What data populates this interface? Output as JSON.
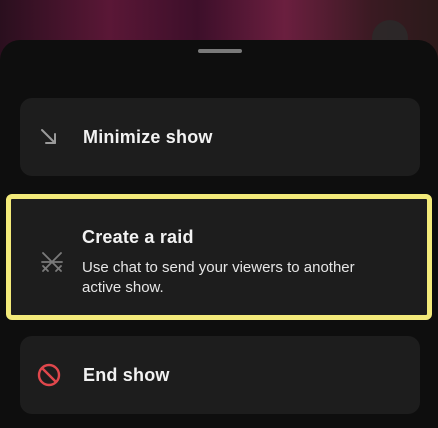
{
  "menu": {
    "items": [
      {
        "label": "Minimize show",
        "icon": "arrow-down-right-icon"
      },
      {
        "label": "Create a raid",
        "description": "Use chat to send your viewers to another active show.",
        "icon": "raid-icon",
        "highlighted": true
      },
      {
        "label": "End show",
        "icon": "prohibited-icon"
      }
    ]
  },
  "colors": {
    "highlight": "#f3ea7a",
    "danger": "#e0474c",
    "row_background": "#1d1d1d"
  }
}
